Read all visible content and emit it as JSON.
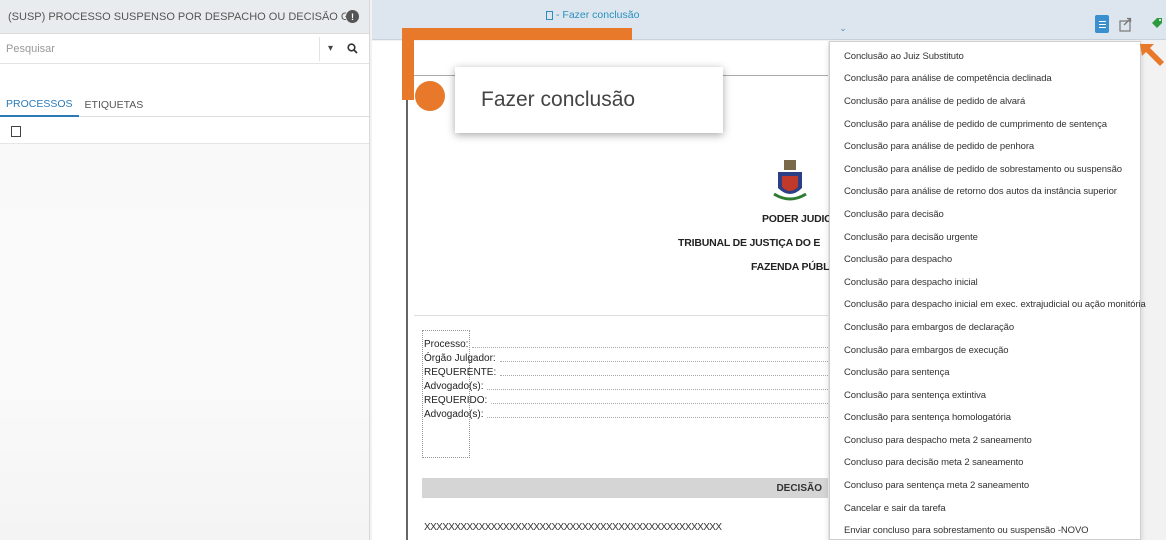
{
  "left_panel": {
    "title": "(SUSP) PROCESSO SUSPENSO POR DESPACHO OU DECISÃO G...",
    "search_placeholder": "Pesquisar",
    "tabs": [
      {
        "label": "PROCESSOS",
        "active": true
      },
      {
        "label": "ETIQUETAS",
        "active": false
      }
    ]
  },
  "topbar": {
    "task_label": "- Fazer conclusão",
    "doc_button_color": "#3a8fce"
  },
  "document": {
    "header_lines": [
      "PODER JUDICIÁ",
      "TRIBUNAL  DE JUSTIÇA DO E",
      "FAZENDA PÚBLICA"
    ],
    "fields": [
      "Processo:",
      "Órgão Julgador:",
      "REQUERENTE:",
      "Advogado(s):",
      "REQUERIDO:",
      "Advogado(s):"
    ],
    "section_title": "DECISÃO",
    "body_text": "XXXXXXXXXXXXXXXXXXXXXXXXXXXXXXXXXXXXXXXXXXXXXXXXX"
  },
  "callout": {
    "label": "Fazer conclusão",
    "color": "#e8782a"
  },
  "menu": {
    "items": [
      "Conclusão ao Juiz Substituto",
      "Conclusão para análise de competência declinada",
      "Conclusão para análise de pedido de alvará",
      "Conclusão para análise de pedido de cumprimento de sentença",
      "Conclusão para análise de pedido de penhora",
      "Conclusão para análise de pedido de sobrestamento ou suspensão",
      "Conclusão para análise de retorno dos autos da instância superior",
      "Conclusão para decisão",
      "Conclusão para decisão urgente",
      "Conclusão para despacho",
      "Conclusão para despacho inicial",
      "Conclusão para despacho inicial em exec. extrajudicial ou ação monitória",
      "Conclusão para embargos de declaração",
      "Conclusão para embargos de execução",
      "Conclusão para sentença",
      "Conclusão para sentença extintiva",
      "Conclusão para sentença homologatória",
      "Concluso para despacho meta 2 saneamento",
      "Concluso para decisão meta 2 saneamento",
      "Concluso para sentença meta 2 saneamento",
      "Cancelar e sair da tarefa",
      "Enviar concluso para sobrestamento ou suspensão -NOVO"
    ]
  }
}
